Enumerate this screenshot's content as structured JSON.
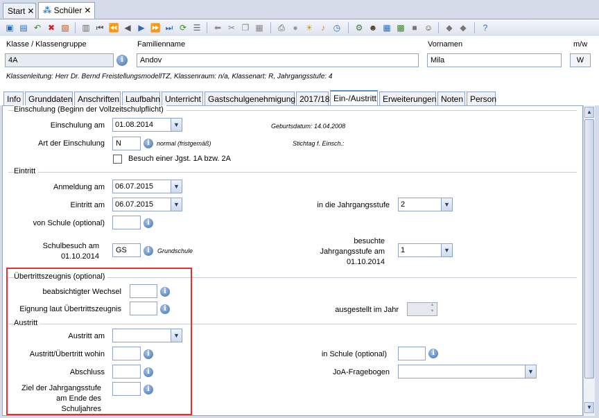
{
  "window_tabs": [
    {
      "label": "Start"
    },
    {
      "label": "Schüler"
    }
  ],
  "header": {
    "klasse_label": "Klasse / Klassengruppe",
    "klasse_value": "4A",
    "familienname_label": "Familienname",
    "familienname_value": "Andov",
    "vornamen_label": "Vornamen",
    "vornamen_value": "Mila",
    "mw_label": "m/w",
    "mw_value": "W",
    "klassenleitung": "Klassenleitung: Herr Dr. Bernd FreistellungsmodellTZ, Klassenraum: n/a, Klassenart: R, Jahrgangsstufe: 4"
  },
  "tabs": [
    {
      "label": "Info"
    },
    {
      "label": "Grunddaten"
    },
    {
      "label": "Anschriften"
    },
    {
      "label": "Laufbahn"
    },
    {
      "label": "Unterricht"
    },
    {
      "label": "Gastschulgenehmigung"
    },
    {
      "label": "2017/18"
    },
    {
      "label": "Ein-/Austritt"
    },
    {
      "label": "Erweiterungen"
    },
    {
      "label": "Noten"
    },
    {
      "label": "Person"
    }
  ],
  "einschulung": {
    "group_title": "Einschulung (Beginn der Vollzeitschulpflicht)",
    "einschulung_am_label": "Einschulung am",
    "einschulung_am_value": "01.08.2014",
    "geburtsdatum": "Geburtsdatum: 14.04.2008",
    "art_label": "Art der Einschulung",
    "art_value": "N",
    "art_text": "normal (fristgemäß)",
    "stichtag": "Stichtag f. Einsch.:",
    "besuch_label": "Besuch einer Jgst. 1A bzw. 2A"
  },
  "eintritt": {
    "group_title": "Eintritt",
    "anmeldung_label": "Anmeldung am",
    "anmeldung_value": "06.07.2015",
    "eintritt_label": "Eintritt am",
    "eintritt_value": "06.07.2015",
    "jgst_label": "in die Jahrgangsstufe",
    "jgst_value": "2",
    "von_schule_label": "von Schule (optional)",
    "schulbesuch_label_1": "Schulbesuch am",
    "schulbesuch_label_2": "01.10.2014",
    "schulbesuch_value": "GS",
    "schulbesuch_text": "Grundschule",
    "besuchte_label_1": "besuchte",
    "besuchte_label_2": "Jahrgangsstufe am",
    "besuchte_label_3": "01.10.2014",
    "besuchte_value": "1"
  },
  "uebertritt": {
    "group_title": "Übertrittszeugnis (optional)",
    "wechsel_label": "beabsichtigter Wechsel",
    "eignung_label": "Eignung laut Übertrittszeugnis",
    "ausgestellt_label": "ausgestellt im Jahr"
  },
  "austritt": {
    "group_title": "Austritt",
    "austritt_am_label": "Austritt am",
    "wohin_label": "Austritt/Übertritt wohin",
    "in_schule_label": "in Schule (optional)",
    "abschluss_label": "Abschluss",
    "joa_label": "JoA-Fragebogen",
    "ziel_label_1": "Ziel der Jahrgangsstufe",
    "ziel_label_2": "am Ende des",
    "ziel_label_3": "Schuljahres"
  }
}
